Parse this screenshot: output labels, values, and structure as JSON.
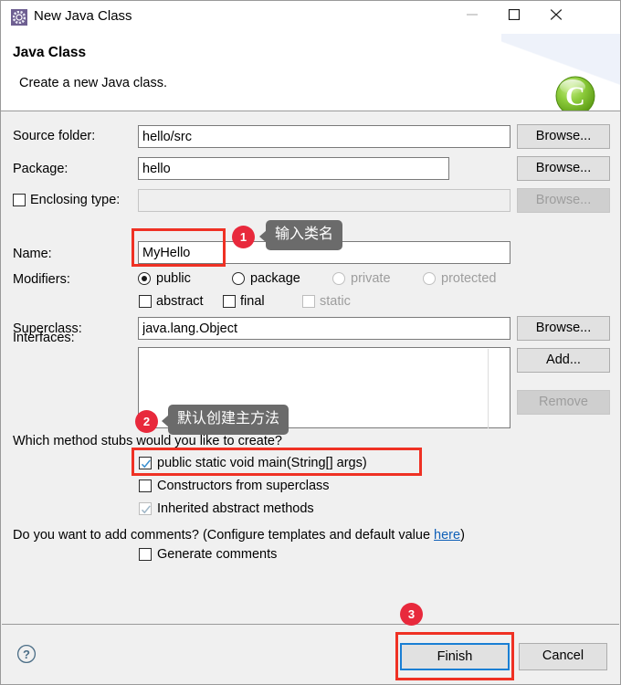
{
  "window": {
    "title": "New Java Class",
    "icon": "java-class-wizard-icon",
    "minimize": "—",
    "maximize": "☐",
    "close": "✕"
  },
  "header": {
    "title": "Java Class",
    "subtitle": "Create a new Java class.",
    "logo": "green-c-sphere-logo"
  },
  "form": {
    "source_folder": {
      "label": "Source folder:",
      "value": "hello/src",
      "browse": "Browse..."
    },
    "package": {
      "label": "Package:",
      "value": "hello",
      "browse": "Browse..."
    },
    "enclosing_type": {
      "label": "Enclosing type:",
      "checked": false,
      "value": "",
      "browse": "Browse...",
      "disabled": true
    },
    "name": {
      "label": "Name:",
      "value": "MyHello"
    },
    "modifiers": {
      "label": "Modifiers:",
      "access": [
        {
          "label": "public",
          "selected": true,
          "disabled": false
        },
        {
          "label": "package",
          "selected": false,
          "disabled": false
        },
        {
          "label": "private",
          "selected": false,
          "disabled": true
        },
        {
          "label": "protected",
          "selected": false,
          "disabled": true
        }
      ],
      "flags": [
        {
          "label": "abstract",
          "checked": false,
          "disabled": false
        },
        {
          "label": "final",
          "checked": false,
          "disabled": false
        },
        {
          "label": "static",
          "checked": false,
          "disabled": true
        }
      ]
    },
    "superclass": {
      "label": "Superclass:",
      "value": "java.lang.Object",
      "browse": "Browse..."
    },
    "interfaces": {
      "label": "Interfaces:",
      "items": [],
      "add": "Add...",
      "remove": "Remove",
      "remove_disabled": true
    },
    "method_stubs": {
      "question": "Which method stubs would you like to create?",
      "options": [
        {
          "label": "public static void main(String[] args)",
          "checked": true,
          "disabled": false
        },
        {
          "label": "Constructors from superclass",
          "checked": false,
          "disabled": false
        },
        {
          "label": "Inherited abstract methods",
          "checked": true,
          "disabled": true
        }
      ]
    },
    "comments": {
      "question_before": "Do you want to add comments? (Configure templates and default value ",
      "link": "here",
      "question_after": ")",
      "checkbox": {
        "label": "Generate comments",
        "checked": false
      }
    }
  },
  "footer": {
    "help_icon": "question-mark-icon",
    "finish": "Finish",
    "cancel": "Cancel"
  },
  "annotations": {
    "badges": [
      {
        "id": "1",
        "text": "1"
      },
      {
        "id": "2",
        "text": "2"
      },
      {
        "id": "3",
        "text": "3"
      }
    ],
    "tooltips": [
      {
        "id": "1",
        "text": "输入类名"
      },
      {
        "id": "2",
        "text": "默认创建主方法"
      }
    ],
    "colors": {
      "highlight_box": "#ef3124",
      "badge": "#e8293c",
      "tooltip_bg": "#6b6b6b",
      "focus_border": "#1a7fd4",
      "link": "#1060b8"
    }
  }
}
